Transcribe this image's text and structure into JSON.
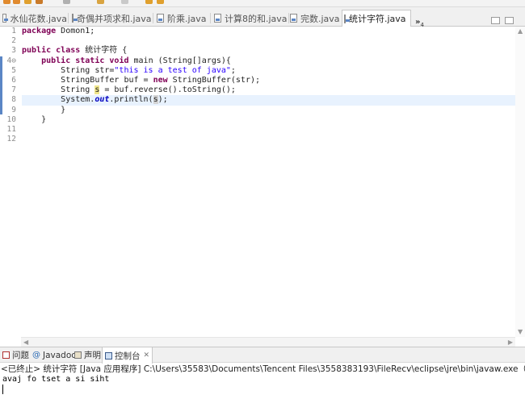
{
  "tabs": [
    {
      "label": "水仙花数.java"
    },
    {
      "label": "奇偶并项求和.java"
    },
    {
      "label": "阶乘.java"
    },
    {
      "label": "计算8的和.java"
    },
    {
      "label": "完数.java"
    },
    {
      "label": "统计字符.java",
      "active": true
    }
  ],
  "tab_close": "✕",
  "tab_overflow": {
    "glyph": "»",
    "count": "4"
  },
  "editor": {
    "line_numbers": [
      "1",
      "2",
      "3",
      "4⊖",
      "5",
      "6",
      "7",
      "8",
      "9",
      "10",
      "11",
      "12"
    ],
    "current_line": 8,
    "code": {
      "l1_kw": "package",
      "l1_rest": " Domon1;",
      "l3_kw1": "public",
      "l3_kw2": "class",
      "l3_rest": " 统计字符 {",
      "l4_kw1": "public",
      "l4_kw2": "static",
      "l4_kw3": "void",
      "l4_rest": " main (String[]args){",
      "l5_a": "String str=",
      "l5_str": "\"this is a test of java\"",
      "l5_b": ";",
      "l6_a": "StringBuffer buf = ",
      "l6_kw": "new",
      "l6_b": " StringBuffer(str);",
      "l7_a": "String ",
      "l7_hl": "s",
      "l7_b": " = buf.reverse().toString();",
      "l8_a": "System.",
      "l8_fld": "out",
      "l8_b": ".println(",
      "l8_hl": "s",
      "l8_c": ");",
      "l9": "}",
      "l10": "}"
    }
  },
  "bottom_tabs": [
    {
      "label": "问题"
    },
    {
      "label": "Javadoc"
    },
    {
      "label": "声明"
    },
    {
      "label": "控制台",
      "active": true
    }
  ],
  "console": {
    "header": "<已终止> 统计字符 [Java 应用程序] C:\\Users\\35583\\Documents\\Tencent Files\\3558383193\\FileRecv\\eclipse\\jre\\bin\\javaw.exe（2019年9月24日 下午1",
    "output": "avaj fo tset a si siht"
  },
  "colors": {
    "keyword": "#7f0055",
    "string": "#2a00ff",
    "field": "#0000c0",
    "current_line": "#e8f2fe",
    "occurrence": "#f0e68c"
  }
}
